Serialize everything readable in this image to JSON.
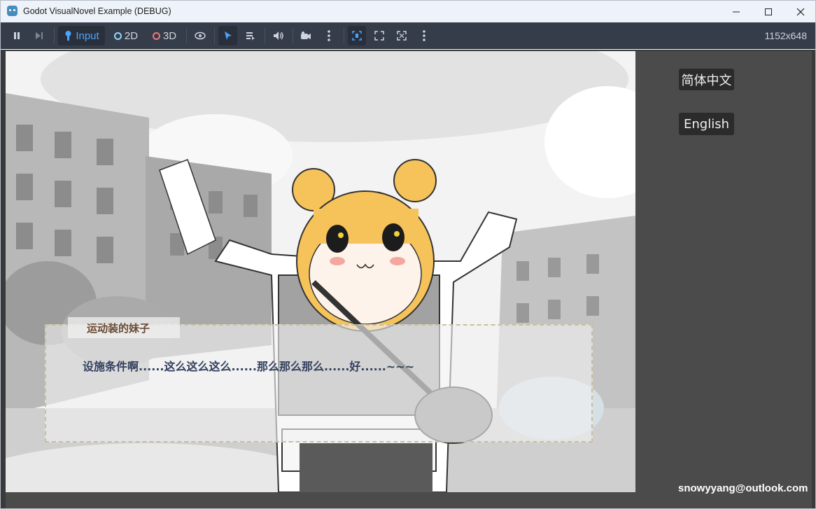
{
  "window": {
    "title": "Godot VisualNovel Example (DEBUG)",
    "controls": [
      "minimize",
      "maximize",
      "close"
    ]
  },
  "toolbar": {
    "input_label": "Input",
    "2d_label": "2D",
    "3d_label": "3D",
    "resolution": "1152x648",
    "colors": {
      "input_icon": "#4aa3ff",
      "2d_icon": "#8fd6ff",
      "3d_icon": "#f07878"
    }
  },
  "sidebar": {
    "lang_zh": "简体中文",
    "lang_en": "English",
    "email": "snowyyang@outlook.com"
  },
  "dialogue": {
    "speaker": "运动装的妹子",
    "text": "设施条件啊......这么这么这么......那么那么那么......好......~~~"
  }
}
